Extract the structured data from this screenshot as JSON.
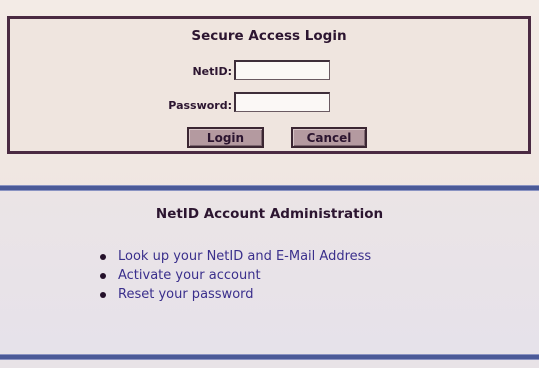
{
  "login": {
    "title": "Secure Access Login",
    "netid_label": "NetID:",
    "netid_value": "",
    "password_label": "Password:",
    "password_value": "",
    "login_button": "Login",
    "cancel_button": "Cancel"
  },
  "admin": {
    "title": "NetID Account Administration",
    "links": [
      "Look up your NetID and E-Mail Address",
      "Activate your account",
      "Reset your password"
    ]
  },
  "colors": {
    "border": "#4a2a42",
    "button": "#b49aa0",
    "link": "#3a2f8c",
    "rule": "#4b5a98"
  }
}
